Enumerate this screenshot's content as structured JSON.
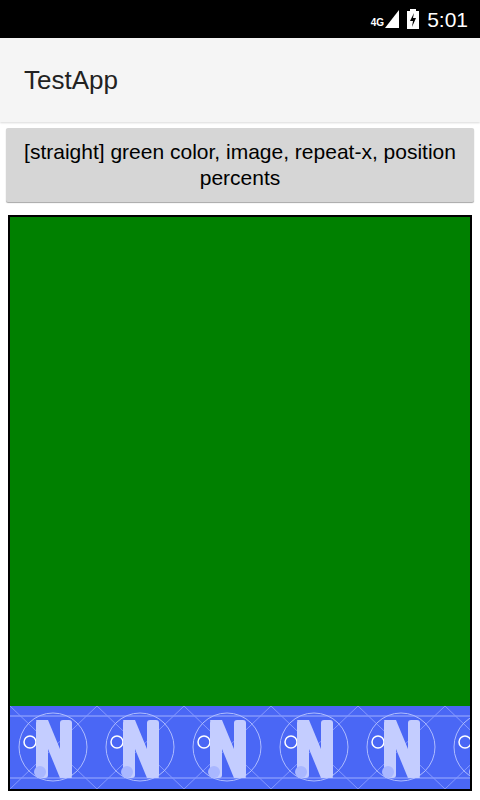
{
  "status_bar": {
    "network": "4G",
    "time": "5:01"
  },
  "app_bar": {
    "title": "TestApp"
  },
  "button": {
    "label": "[straight] green color, image, repeat-x, position percents"
  },
  "panel": {
    "image_repeat": "repeat-x"
  }
}
